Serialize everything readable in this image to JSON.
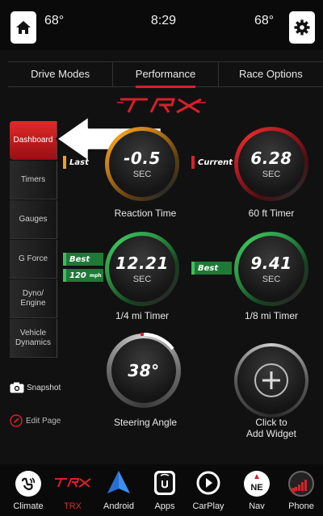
{
  "status": {
    "temp_left": "68°",
    "clock": "8:29",
    "temp_right": "68°"
  },
  "tabs": [
    {
      "label": "Drive Modes",
      "active": false
    },
    {
      "label": "Performance",
      "active": true
    },
    {
      "label": "Race Options",
      "active": false
    }
  ],
  "brand": {
    "logo": "TRX",
    "accent": "#d9202a"
  },
  "side_menu": [
    {
      "label": "Dashboard",
      "active": true
    },
    {
      "label": "Timers",
      "active": false
    },
    {
      "label": "Gauges",
      "active": false
    },
    {
      "label": "G Force",
      "active": false
    },
    {
      "label": "Dyno/\nEngine",
      "active": false
    },
    {
      "label": "Vehicle\nDynamics",
      "active": false
    }
  ],
  "actions": {
    "snapshot": "Snapshot",
    "edit_page": "Edit Page"
  },
  "widgets": {
    "reaction": {
      "tag": "Last",
      "value": "-0.5",
      "unit": "SEC",
      "caption": "Reaction Time",
      "color": "#f0a020"
    },
    "sixty_ft": {
      "tag": "Current",
      "value": "6.28",
      "unit": "SEC",
      "caption": "60 ft Timer",
      "color": "#d9202a"
    },
    "quarter": {
      "tag": "Best",
      "tag2": "120",
      "tag2_unit": "mph",
      "value": "12.21",
      "unit": "SEC",
      "caption": "1/4 mi Timer",
      "color": "#2fa84a"
    },
    "eighth": {
      "tag": "Best",
      "value": "9.41",
      "unit": "SEC",
      "caption": "1/8 mi Timer",
      "color": "#2fa84a"
    },
    "steering": {
      "value": "38°",
      "caption": "Steering Angle"
    },
    "add": {
      "caption_line1": "Click to",
      "caption_line2": "Add Widget"
    }
  },
  "dock": [
    {
      "label": "Climate",
      "icon": "climate-icon"
    },
    {
      "label": "TRX",
      "icon": "trx-logo-icon"
    },
    {
      "label": "Android",
      "icon": "android-auto-icon"
    },
    {
      "label": "Apps",
      "icon": "apps-icon"
    },
    {
      "label": "CarPlay",
      "icon": "carplay-icon"
    },
    {
      "label": "Nav",
      "icon": "compass-icon",
      "badge": "NE"
    },
    {
      "label": "Phone",
      "icon": "phone-signal-icon"
    }
  ]
}
